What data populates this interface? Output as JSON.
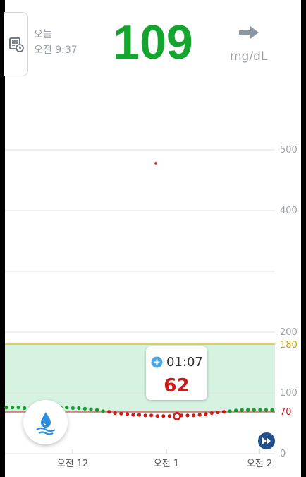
{
  "header": {
    "date_label": "오늘",
    "time_label": "오전 9:37",
    "glucose_value": "109",
    "unit": "mg/dL",
    "trend": "steady",
    "value_color": "#15a52f"
  },
  "chart_data": {
    "type": "scatter",
    "y_ticks": [
      "500",
      "400",
      "200",
      "100",
      "0"
    ],
    "x_ticks": [
      "오전 12",
      "오전 1",
      "오전 2"
    ],
    "target_range": {
      "low": 70,
      "high": 180,
      "low_label": "70",
      "high_label": "180"
    },
    "colors": {
      "in_range": "#16a02c",
      "low": "#d01818",
      "high_line": "#e0c030",
      "band": "#d6f3e1"
    },
    "series": [
      {
        "values": [
          76,
          76,
          76,
          75,
          75,
          75,
          75,
          75,
          76,
          76,
          76,
          75,
          75,
          74,
          73,
          72,
          70,
          69,
          67,
          66,
          65,
          64,
          64,
          63,
          63,
          62,
          62,
          62,
          62,
          63,
          63,
          63,
          64,
          65,
          67,
          68,
          69,
          70,
          71,
          72,
          72,
          72,
          72,
          72,
          72
        ]
      }
    ],
    "outlier": {
      "value": 478
    }
  },
  "tooltip": {
    "time": "01:07",
    "value": "62"
  }
}
